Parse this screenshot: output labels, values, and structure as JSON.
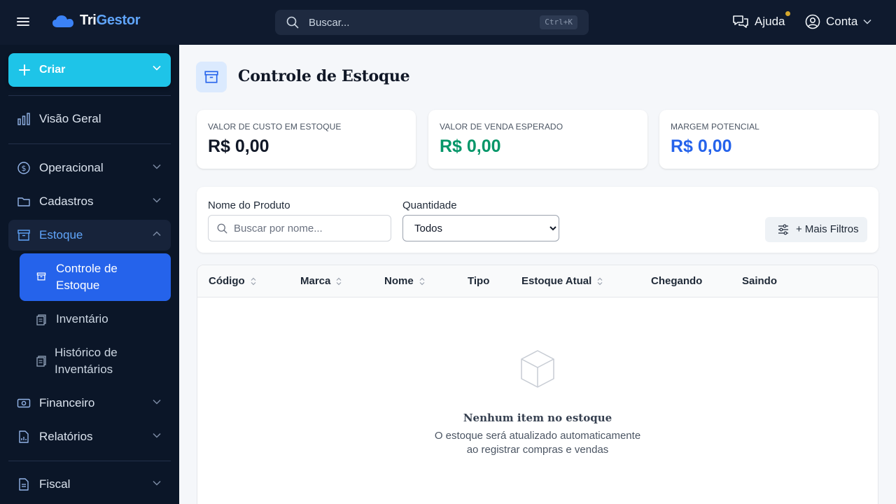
{
  "app": {
    "logo_part1": "Tri",
    "logo_part2": "Gestor"
  },
  "topbar": {
    "search_placeholder": "Buscar...",
    "search_shortcut": "Ctrl+K",
    "help_label": "Ajuda",
    "account_label": "Conta"
  },
  "sidebar": {
    "create_label": "Criar",
    "items": {
      "overview": "Visão Geral",
      "operational": "Operacional",
      "registrations": "Cadastros",
      "stock": "Estoque",
      "stock_control": "Controle de Estoque",
      "inventory": "Inventário",
      "inventory_history": "Histórico de Inventários",
      "financial": "Financeiro",
      "reports": "Relatórios",
      "fiscal": "Fiscal"
    }
  },
  "page": {
    "title": "Controle de Estoque"
  },
  "summary": {
    "cost": {
      "label": "VALOR DE CUSTO EM ESTOQUE",
      "value": "R$ 0,00",
      "color": "#111827"
    },
    "sale": {
      "label": "VALOR DE VENDA ESPERADO",
      "value": "R$ 0,00",
      "color": "#059669"
    },
    "margin": {
      "label": "MARGEM POTENCIAL",
      "value": "R$ 0,00",
      "color": "#2563eb"
    }
  },
  "filters": {
    "name_label": "Nome do Produto",
    "name_placeholder": "Buscar por nome...",
    "qty_label": "Quantidade",
    "qty_selected": "Todos",
    "more_label": "+ Mais Filtros"
  },
  "table": {
    "columns": {
      "code": "Código",
      "brand": "Marca",
      "name": "Nome",
      "type": "Tipo",
      "stock": "Estoque Atual",
      "incoming": "Chegando",
      "outgoing": "Saindo"
    },
    "empty_title": "Nenhum item no estoque",
    "empty_text": "O estoque será atualizado automaticamente ao registrar compras e vendas"
  },
  "colors": {
    "accent": "#2563eb",
    "create_button": "#1ec4e8",
    "topbar": "#0f1a2e",
    "sidebar": "#0b1628"
  }
}
